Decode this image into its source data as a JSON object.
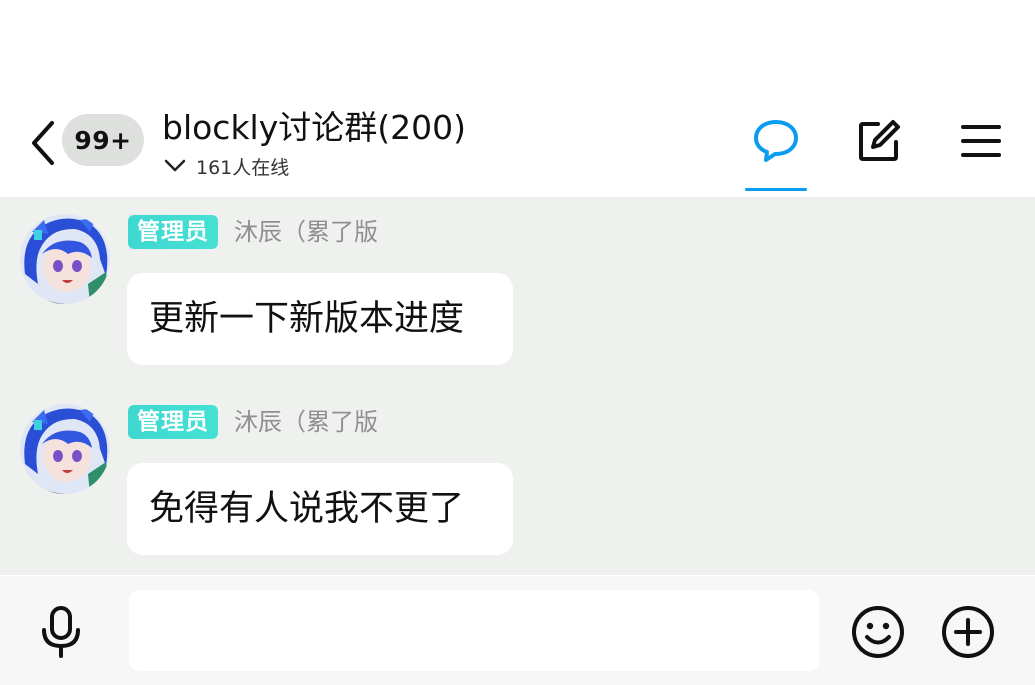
{
  "header": {
    "unread_badge": "99+",
    "group_title": "blockly讨论群(200)",
    "online_text": "161人在线",
    "accent_color": "#0a9cf0",
    "icons": [
      "back-arrow-icon",
      "chat-bubble-icon",
      "edit-note-icon",
      "menu-icon",
      "chevron-down-icon"
    ]
  },
  "messages": [
    {
      "role_tag": "管理员",
      "sender_name": "沐辰（累了版",
      "text": "更新一下新版本进度"
    },
    {
      "role_tag": "管理员",
      "sender_name": "沐辰（累了版",
      "text": "免得有人说我不更了"
    }
  ],
  "input_bar": {
    "placeholder": "",
    "icons": [
      "microphone-icon",
      "emoji-icon",
      "plus-icon"
    ]
  },
  "colors": {
    "chat_background": "#eff1ef",
    "role_tag": "#3dd8cf",
    "badge_background": "#dee0de"
  }
}
